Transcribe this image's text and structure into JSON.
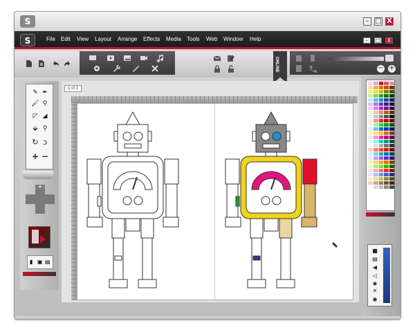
{
  "app": {
    "logo_text": "S"
  },
  "window_controls": {
    "minimize": "–",
    "maximize": "□",
    "close": "X"
  },
  "menu": [
    "File",
    "Edit",
    "View",
    "Layout",
    "Arrange",
    "Effects",
    "Media",
    "Tools",
    "Web",
    "Window",
    "Help"
  ],
  "toolbar": {
    "left_icons": [
      "new-document-icon",
      "open-document-icon",
      "undo-icon",
      "redo-icon"
    ],
    "media_icons": [
      "display-icon",
      "video-icon",
      "image-icon",
      "camera-icon",
      "music-icon"
    ],
    "settings_icons": [
      "gear-icon",
      "wrench-icon",
      "brush-icon",
      "tools-icon"
    ],
    "comm_icons": [
      "mail-icon",
      "edit-icon",
      "lock-icon",
      "unlock-icon"
    ],
    "online_label": "ONLINE",
    "right_icons": [
      "clipboard-icon",
      "mobile-icon",
      "document-icon",
      "phone-icon"
    ],
    "zoom": {
      "out": "−",
      "in": "+"
    }
  },
  "canvas": {
    "page_indicator": "1 of 1"
  },
  "tools": [
    "pencil-icon",
    "pen-icon",
    "brush-icon",
    "eyedropper-icon",
    "select-icon",
    "shape-icon",
    "fill-icon",
    "pin-icon",
    "rotate-icon",
    "spiral-icon",
    "plus-icon",
    "minus-icon"
  ],
  "colors": {
    "accent": "#c8102e",
    "robot_yellow": "#f2d21b",
    "robot_pink": "#e0157e",
    "robot_blue": "#1e90d6",
    "robot_red": "#e0102a",
    "robot_tan": "#d9b46a",
    "robot_green": "#2a9a3a",
    "robot_navy": "#2a3a8a"
  },
  "palette": [
    "#f6d6e6",
    "#e6a8c8",
    "#c8102e",
    "#e05070",
    "#f09090",
    "#f8e0a0",
    "#f0b040",
    "#e07010",
    "#c05000",
    "#803000",
    "#f8f088",
    "#f0e020",
    "#c0c000",
    "#808000",
    "#505000",
    "#c8f0b0",
    "#80d060",
    "#30a030",
    "#107010",
    "#004010",
    "#c0e8f8",
    "#60c0f0",
    "#1e90d6",
    "#1050a0",
    "#002860",
    "#d8c8f0",
    "#a080e0",
    "#6040c0",
    "#402080",
    "#201040",
    "#f0d0f0",
    "#e080e0",
    "#c020c0",
    "#801080",
    "#400840",
    "#fff0e0",
    "#f0c8a0",
    "#d09060",
    "#a06030",
    "#603010",
    "#f0f0f0",
    "#c8c8c8",
    "#909090",
    "#505050",
    "#101010",
    "#ffe8e8",
    "#ff9090",
    "#ff2020",
    "#c00000",
    "#700000",
    "#e8ffe8",
    "#90ff90",
    "#20e020",
    "#00a000",
    "#005000",
    "#e8f0ff",
    "#90b0ff",
    "#2060ff",
    "#0030c0",
    "#001060",
    "#fff8d0",
    "#ffe070",
    "#ffc000",
    "#c08000",
    "#704000",
    "#ffe0f8",
    "#ff90e0",
    "#ff20c0",
    "#c00090",
    "#600050",
    "#e0fff8",
    "#80ffe0",
    "#00e0b0",
    "#00a080",
    "#005040",
    "#f8f8f8",
    "#e0e0e0",
    "#b0b0b0",
    "#707070",
    "#303030",
    "#ffd0c0",
    "#ff8060",
    "#ff4020",
    "#c02000",
    "#601000",
    "#d0f0ff",
    "#80d0ff",
    "#30a0e0",
    "#1070b0",
    "#004070",
    "#f0e0ff",
    "#c0a0ff",
    "#9060f0",
    "#6030c0",
    "#301070",
    "#fff0c0",
    "#ffd080",
    "#ffa040",
    "#e07000",
    "#804000",
    "#e0ffd0",
    "#b0f080",
    "#80e040",
    "#40b000",
    "#206000",
    "#ffe0e0",
    "#ffb0b0",
    "#ff7070",
    "#e03030",
    "#a01010",
    "#e0e8ff",
    "#b0c0ff",
    "#7090f0",
    "#4060d0",
    "#203090",
    "#f0f0d0",
    "#e0e0a0",
    "#c0c060",
    "#909030",
    "#505010",
    "#e8d8c8",
    "#c8a888",
    "#a07858",
    "#705038",
    "#402818",
    "#fafafa",
    "#dcdcdc",
    "#bcbcbc",
    "#8c8c8c",
    "#4c4c4c"
  ],
  "layers_icons": [
    "camera-icon",
    "layers-icon",
    "volume-icon",
    "mute-icon",
    "star-icon",
    "close-icon",
    "settings-icon"
  ]
}
